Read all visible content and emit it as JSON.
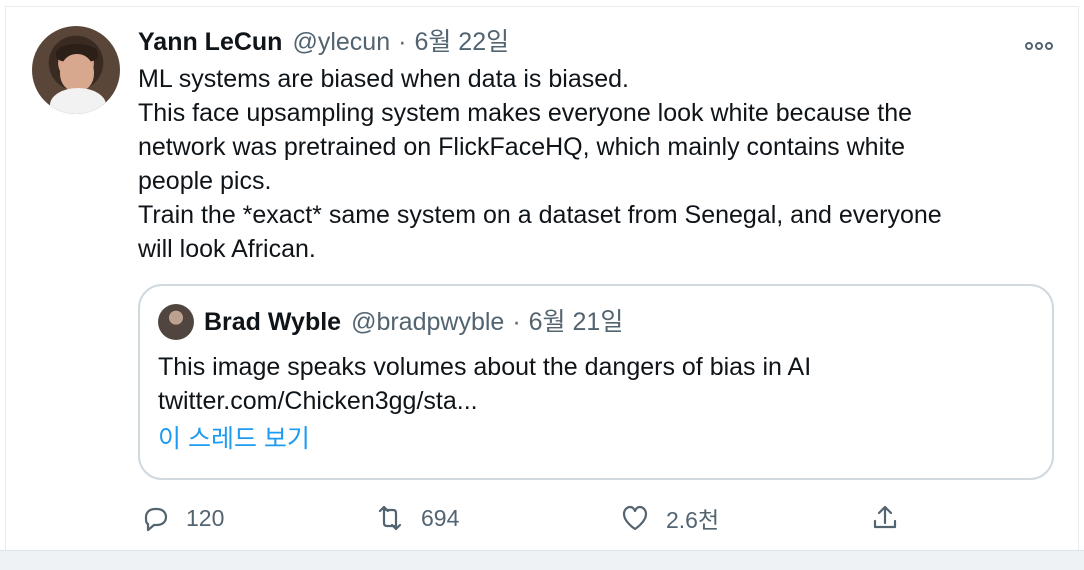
{
  "tweet": {
    "author": "Yann LeCun",
    "handle": "@ylecun",
    "separator": "·",
    "date": "6월 22일",
    "more_icon": "more-icon",
    "lines": [
      "ML systems are biased when data is biased.",
      "This face upsampling system makes everyone look white because the",
      "network was pretrained on FlickFaceHQ, which mainly contains white",
      "people pics.",
      "Train the *exact* same system on a dataset from Senegal, and everyone",
      "will look African."
    ]
  },
  "quoted": {
    "author": "Brad Wyble",
    "handle": "@bradpwyble",
    "separator": "·",
    "date": "6월 21일",
    "lines": [
      "This image speaks volumes about the dangers of bias in AI",
      "twitter.com/Chicken3gg/sta..."
    ],
    "thread_link": "이 스레드 보기"
  },
  "actions": {
    "reply_icon": "reply-icon",
    "reply_count": "120",
    "retweet_icon": "retweet-icon",
    "retweet_count": "694",
    "like_icon": "heart-icon",
    "like_count": "2.6천",
    "share_icon": "share-icon"
  },
  "colors": {
    "text": "#0f1419",
    "secondary": "#536471",
    "link": "#1d9bf0",
    "border": "#cfd9de"
  }
}
